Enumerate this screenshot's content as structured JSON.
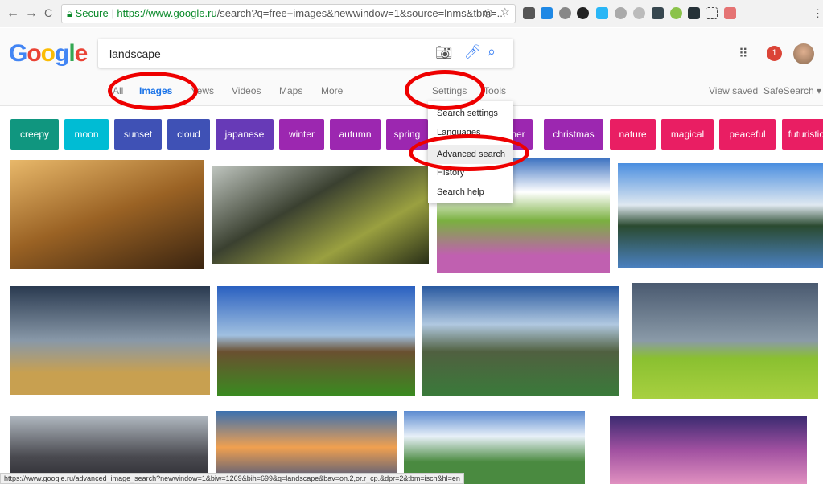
{
  "browser": {
    "secure_label": "Secure",
    "url_host": "https://www.google.ru",
    "url_path": "/search?q=free+images&newwindow=1&source=lnms&tbm=...",
    "back": "←",
    "forward": "→",
    "reload": "C"
  },
  "header": {
    "logo": "Google",
    "query": "landscape",
    "notifications": "1",
    "view_saved": "View saved",
    "safesearch": "SafeSearch ▾"
  },
  "tabs": [
    "All",
    "Images",
    "News",
    "Videos",
    "Maps",
    "More"
  ],
  "active_tab": "Images",
  "tools": {
    "settings": "Settings",
    "tools": "Tools"
  },
  "settings_menu": [
    "Search settings",
    "Languages",
    "Advanced search",
    "History",
    "Search help"
  ],
  "chips": [
    {
      "label": "creepy",
      "color": "#10967f"
    },
    {
      "label": "moon",
      "color": "#00bcd4"
    },
    {
      "label": "sunset",
      "color": "#3f51b5"
    },
    {
      "label": "cloud",
      "color": "#3f51b5"
    },
    {
      "label": "japanese",
      "color": "#673ab7"
    },
    {
      "label": "winter",
      "color": "#9c27b0"
    },
    {
      "label": "autumn",
      "color": "#9c27b0"
    },
    {
      "label": "spring",
      "color": "#9c27b0"
    },
    {
      "label": "summer",
      "color": "#9c27b0"
    },
    {
      "label": "christmas",
      "color": "#9c27b0"
    },
    {
      "label": "nature",
      "color": "#e91e63"
    },
    {
      "label": "magical",
      "color": "#e91e63"
    },
    {
      "label": "peaceful",
      "color": "#e91e63"
    },
    {
      "label": "futuristic",
      "color": "#e91e63"
    }
  ],
  "status_url": "https://www.google.ru/advanced_image_search?newwindow=1&biw=1269&bih=699&q=landscape&bav=on.2,or.r_cp.&dpr=2&tbm=isch&hl=en",
  "annotation_color": "#e00000"
}
